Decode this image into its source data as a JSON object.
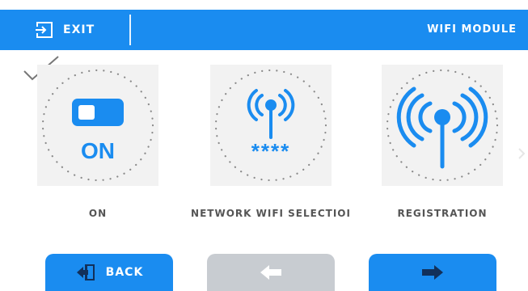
{
  "header": {
    "exit_label": "EXIT",
    "title": "WIFI MODULE"
  },
  "tiles": [
    {
      "label": "ON",
      "icon_text": "ON",
      "selected": true
    },
    {
      "label": "NETWORK WIFI SELECTIOI",
      "icon_text": "****"
    },
    {
      "label": "REGISTRATION"
    }
  ],
  "footer": {
    "back_label": "BACK"
  },
  "colors": {
    "accent": "#1a8cf0",
    "disabled": "#c8ccd1",
    "tile_bg": "#f2f2f2"
  },
  "icons": [
    "exit-icon",
    "checkmark-icon",
    "toggle-icon",
    "wifi-antenna-icon",
    "chevron-right-icon",
    "back-door-icon",
    "arrow-left-icon",
    "arrow-right-icon"
  ]
}
